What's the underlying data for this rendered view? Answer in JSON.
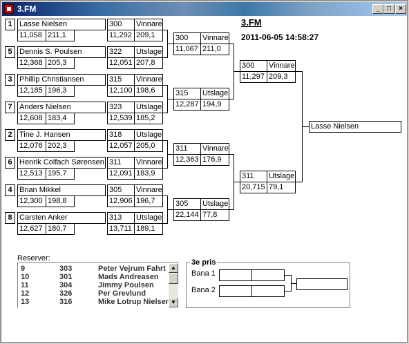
{
  "window": {
    "title": "3.FM"
  },
  "header": {
    "title": "3.FM",
    "datetime": "2011-06-05 14:58:27"
  },
  "round1": [
    {
      "seed": "1",
      "name": "Lasse Nielsen",
      "time": "11,058",
      "speed": "211,1",
      "num": "300",
      "result": "Vinnare",
      "time2": "11,292",
      "speed2": "209,1"
    },
    {
      "seed": "5",
      "name": "Dennis S. Poulsen",
      "time": "12,368",
      "speed": "205,3",
      "num": "322",
      "result": "Utslagen",
      "time2": "12,051",
      "speed2": "207,8"
    },
    {
      "seed": "3",
      "name": "Phillip Christiansen",
      "time": "12,185",
      "speed": "196,3",
      "num": "315",
      "result": "Vinnare",
      "time2": "12,100",
      "speed2": "198,6"
    },
    {
      "seed": "7",
      "name": "Anders Nielsen",
      "time": "12,608",
      "speed": "183,4",
      "num": "323",
      "result": "Utslagen",
      "time2": "12,539",
      "speed2": "185,2"
    },
    {
      "seed": "2",
      "name": "Tine J. Hansen",
      "time": "12,076",
      "speed": "202,3",
      "num": "318",
      "result": "Utslagen",
      "time2": "12,057",
      "speed2": "205,0"
    },
    {
      "seed": "6",
      "name": "Henrik Colfach Sørensen",
      "time": "12,513",
      "speed": "195,7",
      "num": "311",
      "result": "Vinnare",
      "time2": "12,091",
      "speed2": "183,9"
    },
    {
      "seed": "4",
      "name": "Brian Mikkel",
      "time": "12,300",
      "speed": "198,8",
      "num": "305",
      "result": "Vinnare",
      "time2": "12,906",
      "speed2": "196,7"
    },
    {
      "seed": "8",
      "name": "Carsten Anker",
      "time": "12,627",
      "speed": "180,7",
      "num": "313",
      "result": "Utslagen",
      "time2": "13,711",
      "speed2": "189,1"
    }
  ],
  "round2": [
    {
      "num": "300",
      "result": "Vinnare",
      "time": "11,067",
      "speed": "211,0"
    },
    {
      "num": "315",
      "result": "Utslagen",
      "time": "12,287",
      "speed": "194,9"
    },
    {
      "num": "311",
      "result": "Vinnare",
      "time": "12,363",
      "speed": "176,9"
    },
    {
      "num": "305",
      "result": "Utslagen",
      "time": "22,144",
      "speed": "77,8"
    }
  ],
  "semis": [
    {
      "num": "300",
      "result": "Vinnare",
      "time": "11,297",
      "speed": "209,3"
    },
    {
      "num": "311",
      "result": "Utslagen",
      "time": "20,715",
      "speed": "79,1"
    }
  ],
  "winner": "Lasse Nielsen",
  "reserves": {
    "label": "Reserver:",
    "items": [
      {
        "pos": "9",
        "num": "303",
        "name": "Peter Vejrum Fahrt"
      },
      {
        "pos": "10",
        "num": "301",
        "name": "Mads Andreasen"
      },
      {
        "pos": "11",
        "num": "304",
        "name": "Jimmy Poulsen"
      },
      {
        "pos": "12",
        "num": "326",
        "name": "Per Grevlund"
      },
      {
        "pos": "13",
        "num": "316",
        "name": "Mike Lotrup Nielsen"
      }
    ]
  },
  "third_place": {
    "title": "3e pris",
    "lane1": "Bana 1",
    "lane2": "Bana 2"
  }
}
